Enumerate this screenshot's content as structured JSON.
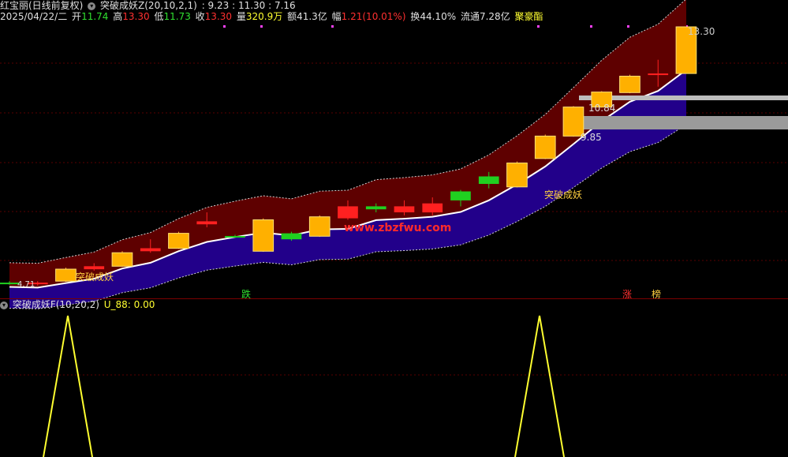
{
  "header": {
    "title": "红宝丽(日线前复权)",
    "indicator_main": "突破成妖Z(20,10,2,1)",
    "indicator_main_values": ": 9.23 : 11.30 : 7.16",
    "date": "2025/04/22/二",
    "open_label": "开",
    "open": "11.74",
    "high_label": "高",
    "high": "13.30",
    "low_label": "低",
    "low": "11.73",
    "close_label": "收",
    "close": "13.30",
    "vol_label": "量",
    "vol": "320.9万",
    "amount_label": "额",
    "amount": "41.3亿",
    "change_label": "幅",
    "change": "1.21(10.01%)",
    "turnover_label": "换",
    "turnover": "44.10%",
    "float_label": "流通",
    "float": "7.28亿",
    "extra": "聚豪酯"
  },
  "sub_header": {
    "indicator": "突破成妖F(10,20,2)",
    "value_label": "U_88:",
    "value": "0.00"
  },
  "annotations": {
    "price_max": "13.30",
    "price_mid": "10.84",
    "price_low": "9.85",
    "signal_1": "突破成妖",
    "signal_2": "突破成妖",
    "left_value": "4.71",
    "watermark": "www.zbzfwu.com",
    "tag_down": "跌",
    "tag_up": "涨",
    "tag_rank": "榜"
  },
  "colors": {
    "background": "#000000",
    "up": "#ff2020",
    "down": "#20d020",
    "band_upper": "#5e0000",
    "band_lower": "#22008a",
    "indicator": "#ffff30"
  },
  "chart_data": {
    "type": "candlestick",
    "x": [
      "d1",
      "d2",
      "d3",
      "d4",
      "d5",
      "d6",
      "d7",
      "d8",
      "d9",
      "d10",
      "d11",
      "d12",
      "d13",
      "d14",
      "d15",
      "d16",
      "d17",
      "d18",
      "d19",
      "d20",
      "d21",
      "d22",
      "d23",
      "d24",
      "d25"
    ],
    "series": [
      {
        "values": [
          {
            "o": 4.71,
            "c": 4.75,
            "h": 4.8,
            "l": 4.68
          },
          {
            "o": 4.75,
            "c": 4.7,
            "h": 4.8,
            "l": 4.65
          },
          {
            "o": 4.8,
            "c": 5.2,
            "h": 5.25,
            "l": 4.78
          },
          {
            "o": 5.3,
            "c": 5.2,
            "h": 5.4,
            "l": 5.15
          },
          {
            "o": 5.3,
            "c": 5.75,
            "h": 5.8,
            "l": 5.28
          },
          {
            "o": 5.9,
            "c": 5.8,
            "h": 6.2,
            "l": 5.75
          },
          {
            "o": 5.9,
            "c": 6.4,
            "h": 6.45,
            "l": 5.88
          },
          {
            "o": 6.8,
            "c": 6.7,
            "h": 7.1,
            "l": 6.6
          },
          {
            "o": 6.3,
            "c": 6.31,
            "h": 6.35,
            "l": 6.25
          },
          {
            "o": 5.8,
            "c": 6.85,
            "h": 6.9,
            "l": 5.78
          },
          {
            "o": 6.2,
            "c": 6.4,
            "h": 6.45,
            "l": 6.15
          },
          {
            "o": 6.3,
            "c": 6.95,
            "h": 7.0,
            "l": 6.28
          },
          {
            "o": 7.3,
            "c": 6.9,
            "h": 7.5,
            "l": 6.85
          },
          {
            "o": 7.2,
            "c": 7.3,
            "h": 7.4,
            "l": 7.1
          },
          {
            "o": 7.3,
            "c": 7.1,
            "h": 7.5,
            "l": 7.0
          },
          {
            "o": 7.4,
            "c": 7.1,
            "h": 7.6,
            "l": 7.0
          },
          {
            "o": 7.5,
            "c": 7.8,
            "h": 7.85,
            "l": 7.3
          },
          {
            "o": 8.05,
            "c": 8.3,
            "h": 8.45,
            "l": 7.9
          },
          {
            "o": 7.95,
            "c": 8.75,
            "h": 8.8,
            "l": 7.93
          },
          {
            "o": 8.9,
            "c": 9.65,
            "h": 9.7,
            "l": 8.88
          },
          {
            "o": 9.65,
            "c": 10.62,
            "h": 10.65,
            "l": 9.63
          },
          {
            "o": 10.62,
            "c": 11.12,
            "h": 11.15,
            "l": 10.6
          },
          {
            "o": 11.1,
            "c": 11.65,
            "h": 11.7,
            "l": 11.08
          },
          {
            "o": 11.74,
            "c": 11.74,
            "h": 12.2,
            "l": 11.3
          },
          {
            "o": 11.74,
            "c": 13.3,
            "h": 13.3,
            "l": 11.73
          }
        ]
      }
    ]
  }
}
